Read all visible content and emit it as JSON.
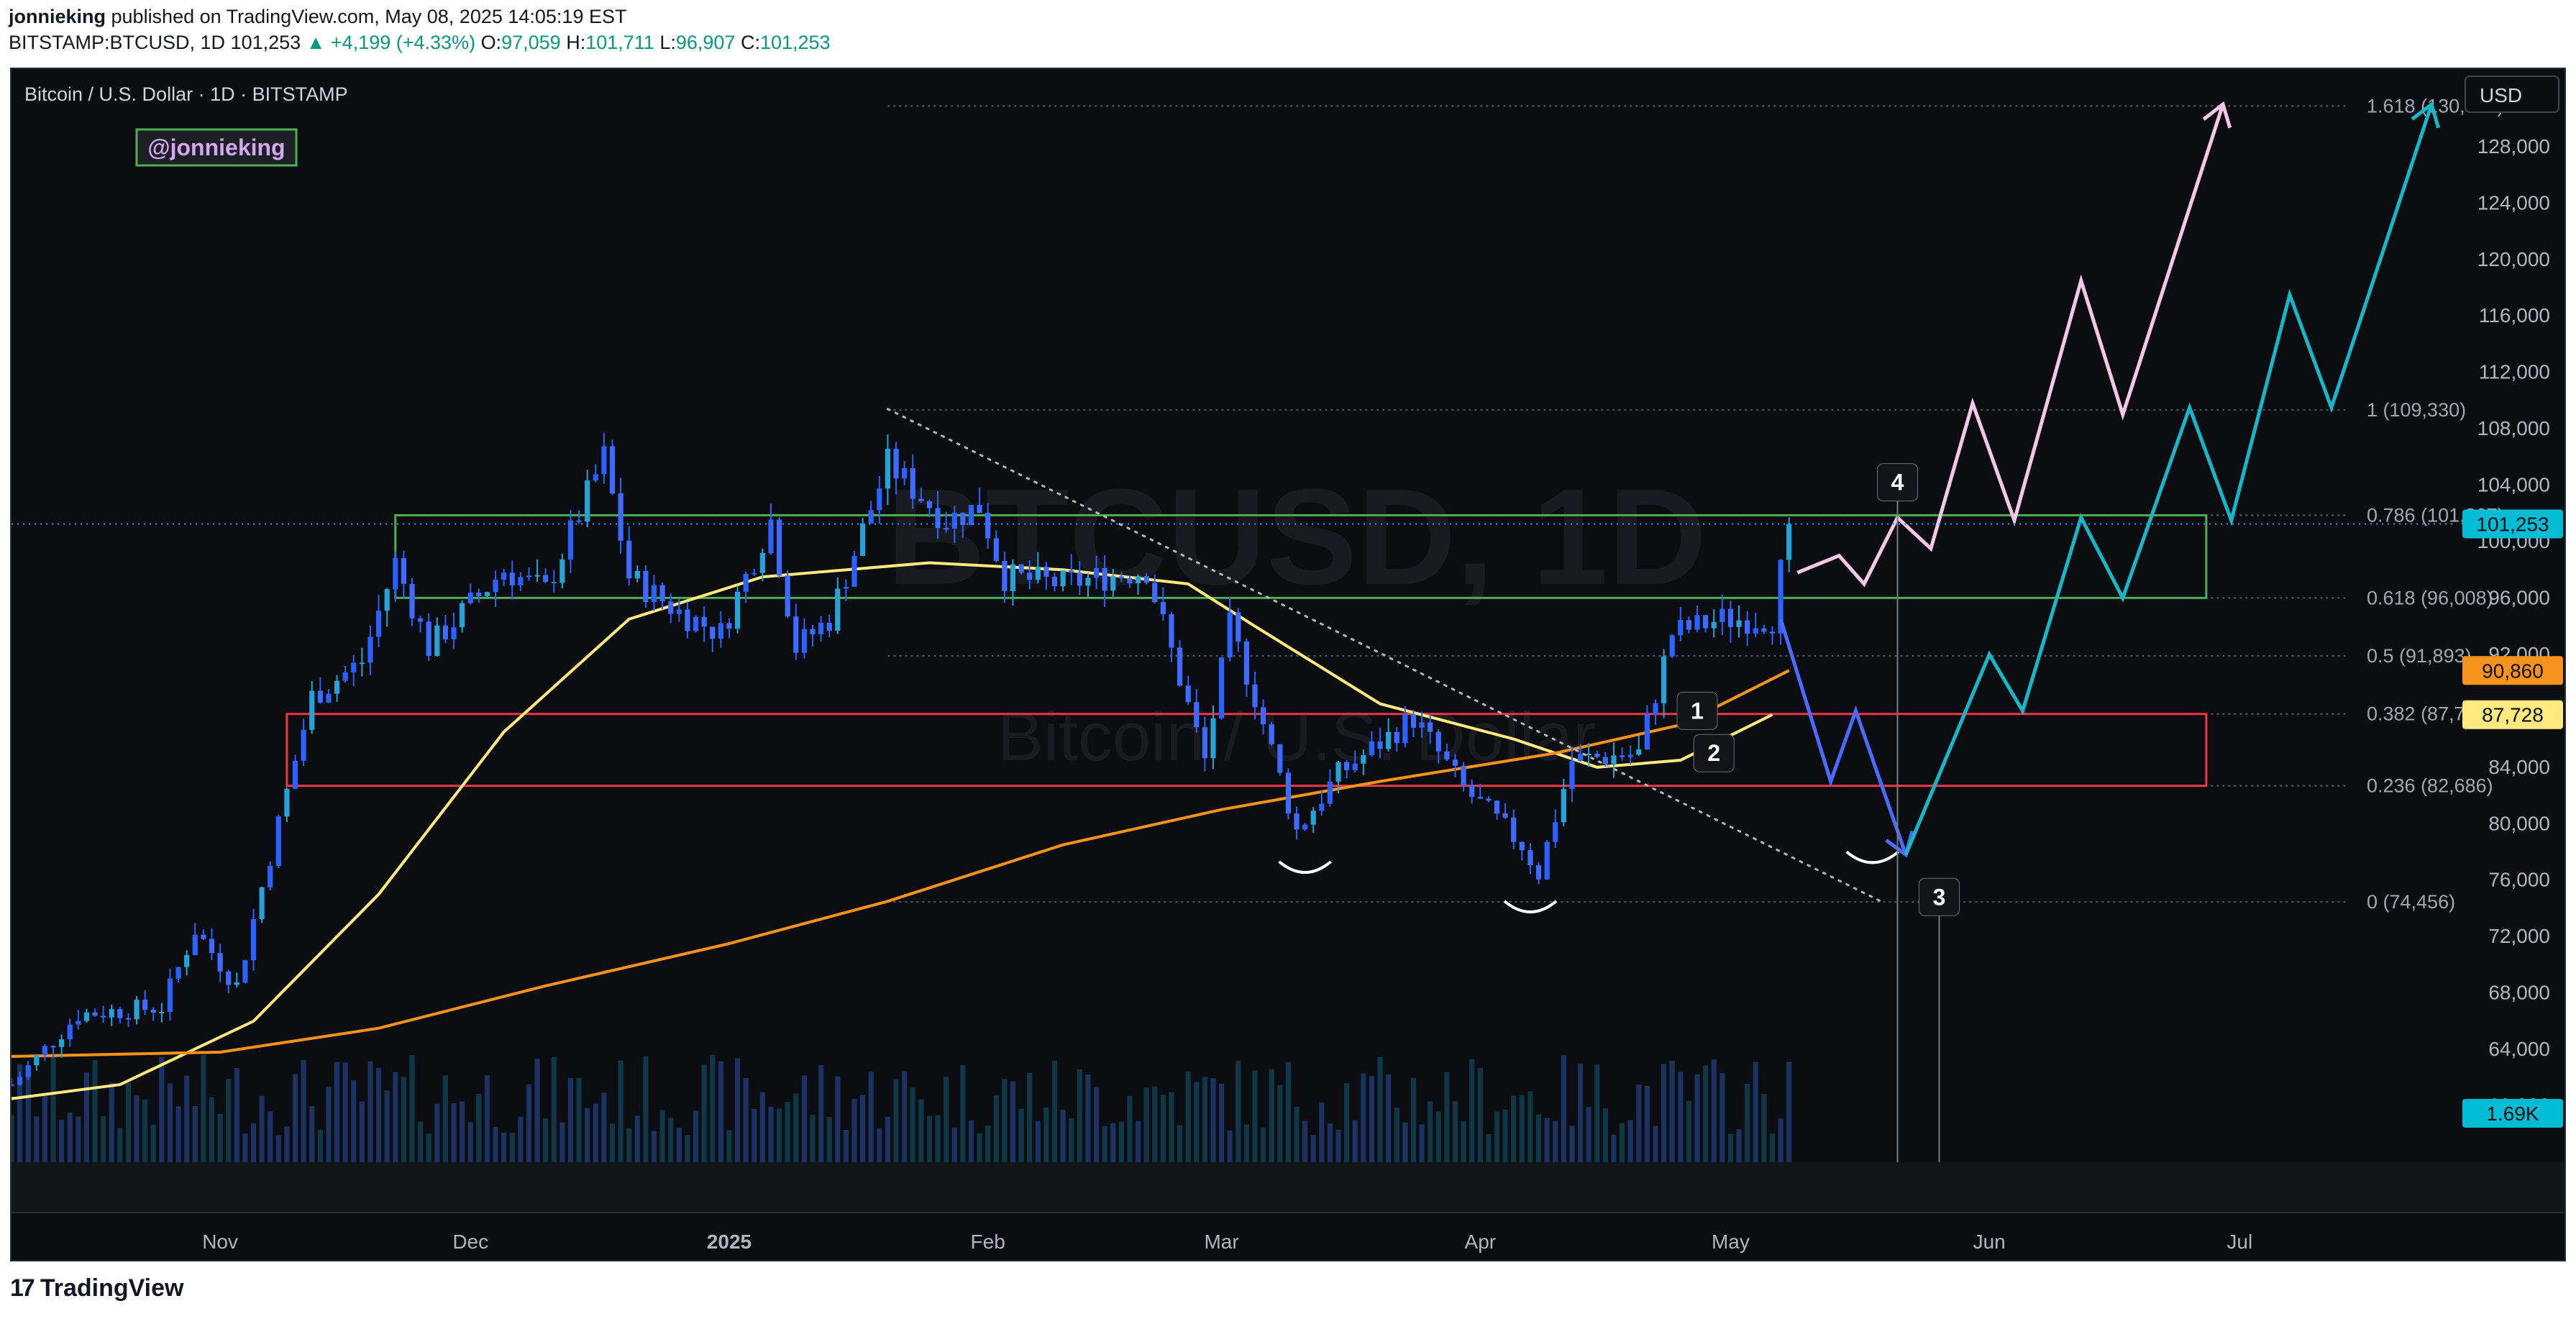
{
  "header": {
    "author": "jonnieking",
    "published_text": "published on TradingView.com, May 08, 2025 14:05:19 EST",
    "symbol": "BITSTAMP:BTCUSD, 1D",
    "last": "101,253",
    "change": "▲ +4,199 (+4.33%)",
    "o_label": "O:",
    "o": "97,059",
    "h_label": "H:",
    "h": "101,711",
    "l_label": "L:",
    "l": "96,907",
    "c_label": "C:",
    "c": "101,253"
  },
  "footer": {
    "logo_mark": "17",
    "brand": "TradingView"
  },
  "chart_data": {
    "type": "candlestick",
    "title": "Bitcoin / U.S. Dollar · 1D · BITSTAMP",
    "watermark_symbol": "BTCUSD, 1D",
    "watermark_name": "Bitcoin / U.S. Dollar",
    "author_tag": "@jonnieking",
    "currency": "USD",
    "ylim": [
      56000,
      133500
    ],
    "y_ticks": [
      60000,
      64000,
      68000,
      72000,
      76000,
      80000,
      84000,
      88000,
      92000,
      96000,
      100000,
      104000,
      108000,
      112000,
      116000,
      120000,
      124000,
      128000,
      132000
    ],
    "y_tick_labels": [
      "60,000",
      "64,000",
      "68,000",
      "72,000",
      "76,000",
      "80,000",
      "84,000",
      "88,000",
      "92,000",
      "96,000",
      "100,000",
      "104,000",
      "108,000",
      "112,000",
      "116,000",
      "120,000",
      "124,000",
      "128,000",
      "132,000"
    ],
    "x_range": [
      "2024-10-07",
      "2025-07-27"
    ],
    "x_ticks": [
      {
        "date": "2024-11-01",
        "label": "Nov",
        "bold": false
      },
      {
        "date": "2024-12-01",
        "label": "Dec",
        "bold": false
      },
      {
        "date": "2025-01-01",
        "label": "2025",
        "bold": true
      },
      {
        "date": "2025-02-01",
        "label": "Feb",
        "bold": false
      },
      {
        "date": "2025-03-01",
        "label": "Mar",
        "bold": false
      },
      {
        "date": "2025-04-01",
        "label": "Apr",
        "bold": false
      },
      {
        "date": "2025-05-01",
        "label": "May",
        "bold": false
      },
      {
        "date": "2025-06-01",
        "label": "Jun",
        "bold": false
      },
      {
        "date": "2025-07-01",
        "label": "Jul",
        "bold": false
      }
    ],
    "price_path": {
      "start_date": "2024-10-07",
      "end_date": "2025-05-08",
      "anchors": [
        [
          "2024-10-07",
          61500
        ],
        [
          "2024-10-15",
          66500
        ],
        [
          "2024-10-25",
          67000
        ],
        [
          "2024-10-29",
          72500
        ],
        [
          "2024-11-03",
          68500
        ],
        [
          "2024-11-06",
          75500
        ],
        [
          "2024-11-12",
          89000
        ],
        [
          "2024-11-18",
          91500
        ],
        [
          "2024-11-22",
          98500
        ],
        [
          "2024-11-26",
          92500
        ],
        [
          "2024-12-05",
          98000
        ],
        [
          "2024-12-10",
          96500
        ],
        [
          "2024-12-17",
          106000
        ],
        [
          "2024-12-20",
          97500
        ],
        [
          "2024-12-26",
          95000
        ],
        [
          "2024-12-31",
          93500
        ],
        [
          "2025-01-06",
          101500
        ],
        [
          "2025-01-09",
          92500
        ],
        [
          "2025-01-13",
          94500
        ],
        [
          "2025-01-20",
          105500
        ],
        [
          "2025-01-27",
          101500
        ],
        [
          "2025-01-31",
          102500
        ],
        [
          "2025-02-03",
          97500
        ],
        [
          "2025-02-10",
          97000
        ],
        [
          "2025-02-20",
          98000
        ],
        [
          "2025-02-27",
          84500
        ],
        [
          "2025-03-02",
          94000
        ],
        [
          "2025-03-05",
          89000
        ],
        [
          "2025-03-10",
          79500
        ],
        [
          "2025-03-15",
          83500
        ],
        [
          "2025-03-24",
          87500
        ],
        [
          "2025-03-30",
          82500
        ],
        [
          "2025-04-06",
          78500
        ],
        [
          "2025-04-08",
          76500
        ],
        [
          "2025-04-12",
          84500
        ],
        [
          "2025-04-20",
          85000
        ],
        [
          "2025-04-24",
          93500
        ],
        [
          "2025-04-30",
          94500
        ],
        [
          "2025-05-06",
          94500
        ],
        [
          "2025-05-08",
          101253
        ]
      ],
      "up_color": "#2962ff",
      "up_alt_color": "#26a3d6",
      "down_color": "#2962ff"
    },
    "volume": {
      "last_label": "1.69K"
    },
    "moving_averages": [
      {
        "color": "#ffea80",
        "last_label": "87,728",
        "points": [
          [
            "2024-10-07",
            60500
          ],
          [
            "2024-10-20",
            61500
          ],
          [
            "2024-11-05",
            66000
          ],
          [
            "2024-11-20",
            75000
          ],
          [
            "2024-12-05",
            86500
          ],
          [
            "2024-12-20",
            94500
          ],
          [
            "2025-01-05",
            97500
          ],
          [
            "2025-01-25",
            98500
          ],
          [
            "2025-02-10",
            98000
          ],
          [
            "2025-02-25",
            97000
          ],
          [
            "2025-03-05",
            94000
          ],
          [
            "2025-03-20",
            88500
          ],
          [
            "2025-04-05",
            86000
          ],
          [
            "2025-04-15",
            84000
          ],
          [
            "2025-04-25",
            84500
          ],
          [
            "2025-05-06",
            87728
          ]
        ]
      },
      {
        "color": "#f7931a",
        "last_label": "90,860",
        "points": [
          [
            "2024-10-07",
            63500
          ],
          [
            "2024-11-01",
            63800
          ],
          [
            "2024-11-20",
            65500
          ],
          [
            "2024-12-10",
            68500
          ],
          [
            "2025-01-01",
            71500
          ],
          [
            "2025-01-20",
            74500
          ],
          [
            "2025-02-10",
            78500
          ],
          [
            "2025-03-01",
            81000
          ],
          [
            "2025-03-20",
            83000
          ],
          [
            "2025-04-10",
            85000
          ],
          [
            "2025-04-25",
            87000
          ],
          [
            "2025-05-08",
            90860
          ]
        ]
      }
    ],
    "last_price_label": "101,253",
    "fib_levels": [
      {
        "label": "1.618 (130,882)",
        "price": 130882
      },
      {
        "label": "1 (109,330)",
        "price": 109330
      },
      {
        "label": "0.786 (101,867)",
        "price": 101867
      },
      {
        "label": "0.618 (96,008)",
        "price": 96008
      },
      {
        "label": "0.5 (91,893)",
        "price": 91893
      },
      {
        "label": "0.382 (87,778)",
        "price": 87778
      },
      {
        "label": "0.236 (82,686)",
        "price": 82686
      },
      {
        "label": "0 (74,456)",
        "price": 74456
      }
    ],
    "fib_start_date": "2025-01-20",
    "zones": [
      {
        "color": "#4caf50",
        "from_date": "2024-11-22",
        "to_date": "2025-06-27",
        "low": 96008,
        "high": 101867
      },
      {
        "color": "#f23645",
        "from_date": "2024-11-09",
        "to_date": "2025-06-27",
        "low": 82686,
        "high": 87778
      }
    ],
    "downtrend_line": {
      "color": "#b2b5be",
      "from": [
        "2025-01-20",
        109400
      ],
      "to": [
        "2025-05-19",
        74500
      ]
    },
    "smile_markers": [
      {
        "date": "2025-03-11",
        "price": 76900
      },
      {
        "date": "2025-04-07",
        "price": 74100
      },
      {
        "date": "2025-05-18",
        "price": 77600
      }
    ],
    "labels": [
      {
        "text": "1",
        "date": "2025-04-27",
        "price": 88000
      },
      {
        "text": "2",
        "date": "2025-04-29",
        "price": 85000
      },
      {
        "text": "3",
        "date": "2025-05-26",
        "price": 74800
      },
      {
        "text": "4",
        "date": "2025-05-21",
        "price": 104200
      }
    ],
    "label3_line_bottom_price": 58500,
    "projections": [
      {
        "color": "#f2c8e8",
        "points": [
          [
            "2025-05-09",
            97800
          ],
          [
            "2025-05-14",
            99000
          ],
          [
            "2025-05-17",
            97000
          ],
          [
            "2025-05-21",
            101700
          ],
          [
            "2025-05-25",
            99500
          ],
          [
            "2025-05-30",
            109800
          ],
          [
            "2025-06-04",
            101500
          ],
          [
            "2025-06-12",
            118500
          ],
          [
            "2025-06-17",
            109000
          ],
          [
            "2025-06-29",
            131000
          ]
        ]
      },
      {
        "color": "#4a6bff",
        "points": [
          [
            "2025-05-07",
            94500
          ],
          [
            "2025-05-13",
            83000
          ],
          [
            "2025-05-16",
            88000
          ],
          [
            "2025-05-22",
            77800
          ]
        ]
      },
      {
        "color": "#14b8c8",
        "points": [
          [
            "2025-05-22",
            77800
          ],
          [
            "2025-06-01",
            92000
          ],
          [
            "2025-06-05",
            88000
          ],
          [
            "2025-06-12",
            101700
          ],
          [
            "2025-06-17",
            96000
          ],
          [
            "2025-06-25",
            109500
          ],
          [
            "2025-06-30",
            101500
          ],
          [
            "2025-07-07",
            117500
          ],
          [
            "2025-07-12",
            109500
          ],
          [
            "2025-07-24",
            131000
          ]
        ]
      }
    ]
  }
}
